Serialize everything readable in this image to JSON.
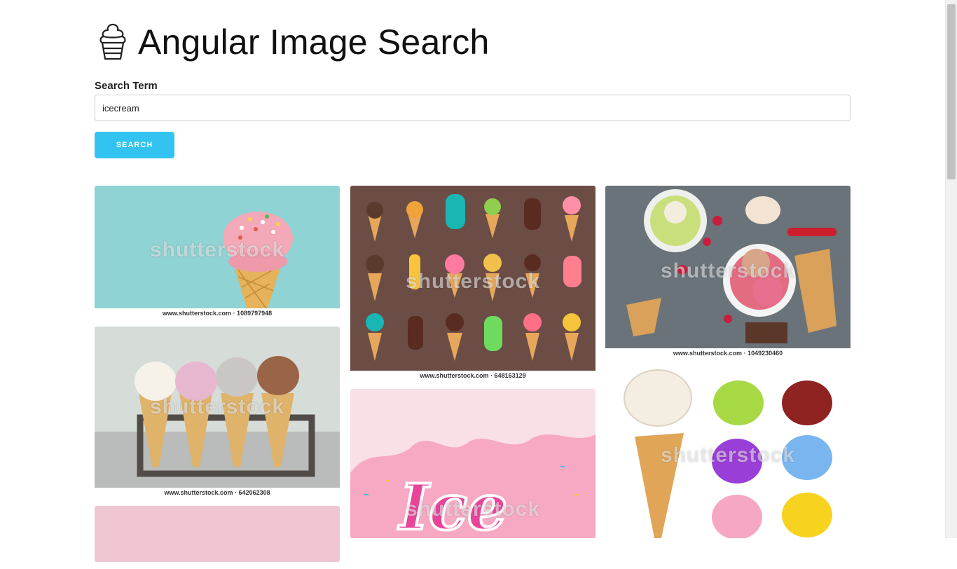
{
  "app": {
    "title": "Angular Image Search",
    "logo_icon": "ice-cream-icon"
  },
  "search": {
    "label": "Search Term",
    "value": "icecream",
    "button_label": "SEARCH",
    "button_color": "#33c3f0"
  },
  "results": {
    "watermark": "shutterstock",
    "images": [
      {
        "caption": "www.shutterstock.com · 1089797948",
        "subject": "pink ice cream cone on teal"
      },
      {
        "caption": "www.shutterstock.com · 642062308",
        "subject": "four ice cream cones in stand"
      },
      {
        "caption": "www.shutterstock.com · 648163129",
        "subject": "ice cream icons pattern on brown"
      },
      {
        "caption": "",
        "subject": "pink ice cream lettering"
      },
      {
        "caption": "www.shutterstock.com · 1049230460",
        "subject": "ice cream bowls with berries"
      },
      {
        "caption": "",
        "subject": "ice cream scoops and cone"
      }
    ]
  }
}
